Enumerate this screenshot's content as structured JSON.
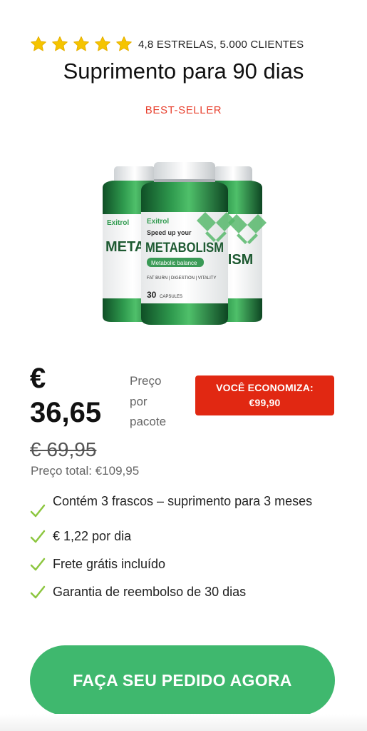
{
  "rating": {
    "star_count": 5,
    "star_color": "#f5c400",
    "text": "4,8 ESTRELAS, 5.000 CLIENTES"
  },
  "title": "Suprimento para 90 dias",
  "badge": "BEST-SELLER",
  "product": {
    "bottle_brand": "Exitrol",
    "bottle_tagline": "Speed up your",
    "bottle_name": "METABOLISM",
    "bottle_sub": "Metabolic balance",
    "bottle_benefits": "FAT BURN | DIGESTION | VITALITY",
    "bottle_caps": "30",
    "bottle_caps_label": "CAPSULES",
    "bottle_front_cut": "METAE",
    "bottle_back_cut": "OLISM"
  },
  "pricing": {
    "currency_symbol": "€",
    "price": "36,65",
    "price_note_lines": [
      "Preço",
      "por",
      "pacote"
    ],
    "old_price": "€ 69,95",
    "savings_label": "VOCÊ ECONOMIZA:",
    "savings_amount": "€99,90",
    "savings_color": "#e12812",
    "total": "Preço total: €109,95"
  },
  "features": [
    "Contém 3 frascos – suprimento para 3 meses",
    "€ 1,22 por dia",
    "Frete grátis incluído",
    "Garantia de reembolso de 30 dias"
  ],
  "check_color": "#8cc63f",
  "cta": {
    "label": "FAÇA SEU PEDIDO AGORA",
    "color": "#3fb86e"
  }
}
